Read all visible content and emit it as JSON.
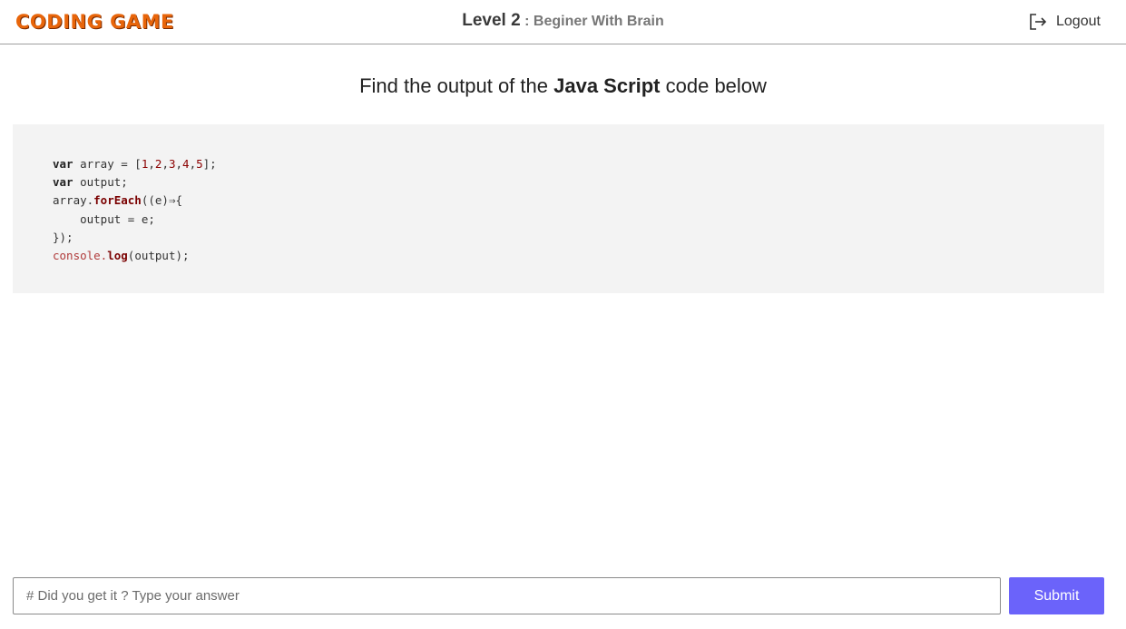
{
  "header": {
    "logo": "CODING GAME",
    "level_label": "Level 2",
    "level_subtitle": " : Beginer With Brain",
    "logout_icon": "logout-icon",
    "logout_label": "Logout"
  },
  "question": {
    "prefix": "Find the output of the ",
    "language": "Java Script",
    "suffix": " code below"
  },
  "code": {
    "line1": {
      "kw": "var",
      "text1": " array = [",
      "n1": "1",
      "c1": ",",
      "n2": "2",
      "c2": ",",
      "n3": "3",
      "c3": ",",
      "n4": "4",
      "c4": ",",
      "n5": "5",
      "text2": "];"
    },
    "line2": {
      "kw": "var",
      "text": " output;"
    },
    "line3": {
      "obj": "array.",
      "fn": "forEach",
      "text": "((e)⇒{"
    },
    "line4": {
      "text": "    output = e;"
    },
    "line5": {
      "text": "});"
    },
    "line6": {
      "obj": "console.",
      "fn": "log",
      "text": "(output);"
    }
  },
  "answer": {
    "placeholder": "# Did you get it ? Type your answer",
    "value": "",
    "submit_label": "Submit"
  },
  "colors": {
    "accent": "#6b63fa",
    "logo": "#e8650a",
    "code_bg": "#f3f3f3"
  }
}
